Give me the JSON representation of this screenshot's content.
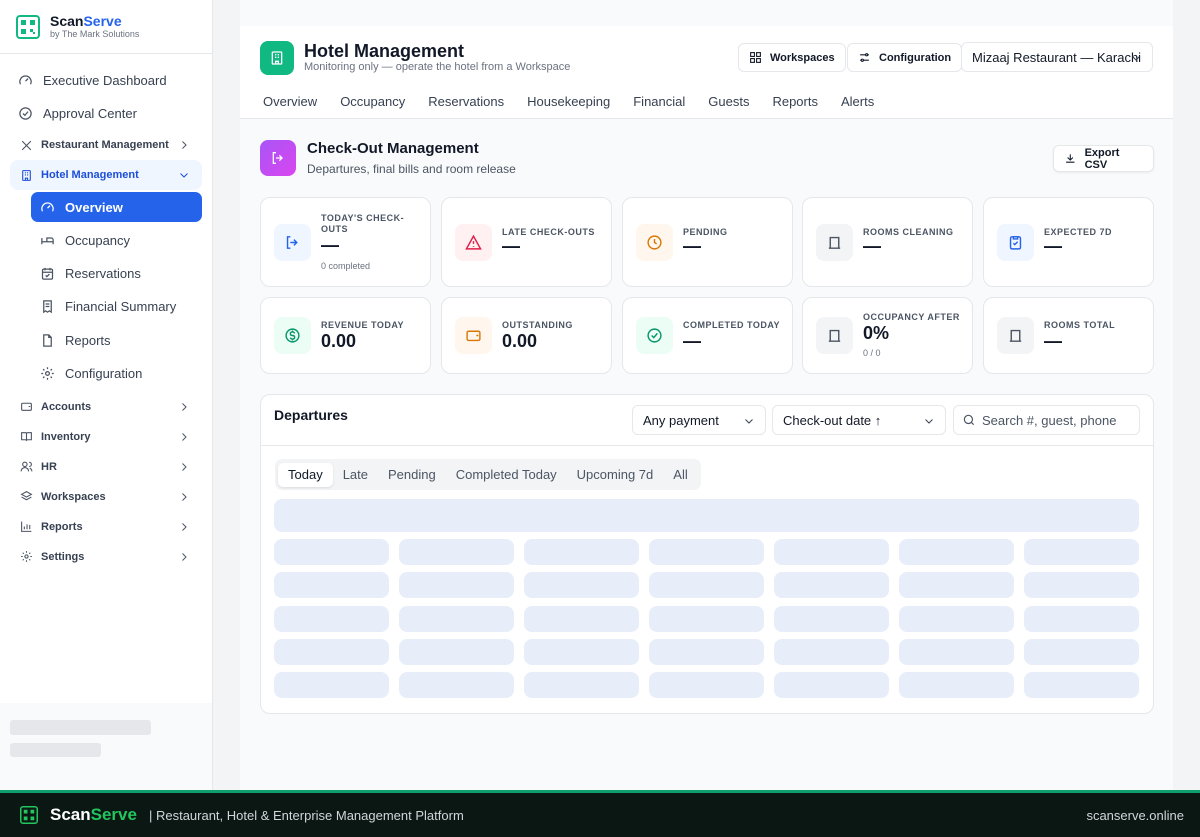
{
  "brand": {
    "name_main": "Scan",
    "name_accent": "Serve",
    "sub": "by The Mark Solutions"
  },
  "sidebar": {
    "top_items": [
      {
        "label": "Executive Dashboard",
        "icon": "gauge-icon"
      },
      {
        "label": "Approval Center",
        "icon": "check-circle-icon"
      }
    ],
    "groups_before": [
      {
        "label": "Restaurant Management",
        "icon": "utensils-icon"
      }
    ],
    "active_group": {
      "label": "Hotel Management",
      "icon": "building-icon"
    },
    "sub_items": [
      {
        "label": "Overview",
        "icon": "gauge-icon",
        "active": true
      },
      {
        "label": "Occupancy",
        "icon": "bed-icon"
      },
      {
        "label": "Reservations",
        "icon": "calendar-check-icon"
      },
      {
        "label": "Financial Summary",
        "icon": "receipt-icon"
      },
      {
        "label": "Reports",
        "icon": "file-icon"
      },
      {
        "label": "Configuration",
        "icon": "gear-icon"
      }
    ],
    "groups_after": [
      {
        "label": "Accounts",
        "icon": "wallet-icon"
      },
      {
        "label": "Inventory",
        "icon": "book-icon"
      },
      {
        "label": "HR",
        "icon": "users-icon"
      },
      {
        "label": "Workspaces",
        "icon": "layers-icon"
      },
      {
        "label": "Reports",
        "icon": "chart-icon"
      },
      {
        "label": "Settings",
        "icon": "gear-icon"
      }
    ]
  },
  "header": {
    "title": "Hotel Management",
    "subtitle": "Monitoring only — operate the hotel from a Workspace",
    "workspaces_label": "Workspaces",
    "configuration_label": "Configuration",
    "branch_select": "Mizaaj Restaurant — Karachi",
    "tabs": [
      "Overview",
      "Occupancy",
      "Reservations",
      "Housekeeping",
      "Financial",
      "Guests",
      "Reports",
      "Alerts"
    ]
  },
  "section": {
    "title": "Check-Out Management",
    "subtitle": "Departures, final bills and room release",
    "export_label": "Export CSV"
  },
  "stats": [
    {
      "label": "TODAY'S CHECK-OUTS",
      "value": "—",
      "sub": "0 completed",
      "icon": "logout-icon",
      "color": "#2563eb",
      "bg": "#eff6ff"
    },
    {
      "label": "LATE CHECK-OUTS",
      "value": "—",
      "sub": "",
      "icon": "alert-triangle-icon",
      "color": "#e11d48",
      "bg": "#fff1f2"
    },
    {
      "label": "PENDING",
      "value": "—",
      "sub": "",
      "icon": "clock-icon",
      "color": "#d97706",
      "bg": "#fff7ed"
    },
    {
      "label": "ROOMS CLEANING",
      "value": "—",
      "sub": "",
      "icon": "door-icon",
      "color": "#4b5563",
      "bg": "#f3f4f6"
    },
    {
      "label": "EXPECTED 7D",
      "value": "—",
      "sub": "",
      "icon": "clipboard-check-icon",
      "color": "#2563eb",
      "bg": "#eff6ff"
    },
    {
      "label": "REVENUE TODAY",
      "value": "0.00",
      "sub": "",
      "icon": "dollar-icon",
      "color": "#059669",
      "bg": "#ecfdf5"
    },
    {
      "label": "OUTSTANDING",
      "value": "0.00",
      "sub": "",
      "icon": "wallet-icon",
      "color": "#d97706",
      "bg": "#fff7ed"
    },
    {
      "label": "COMPLETED TODAY",
      "value": "—",
      "sub": "",
      "icon": "check-circle-icon",
      "color": "#059669",
      "bg": "#ecfdf5"
    },
    {
      "label": "OCCUPANCY AFTER",
      "value": "0%",
      "sub": "0 / 0",
      "icon": "door-icon",
      "color": "#4b5563",
      "bg": "#f3f4f6"
    },
    {
      "label": "ROOMS TOTAL",
      "value": "—",
      "sub": "",
      "icon": "door-icon",
      "color": "#4b5563",
      "bg": "#f3f4f6"
    }
  ],
  "departures": {
    "title": "Departures",
    "payment_filter": "Any payment",
    "sort_select": "Check-out date ↑",
    "search_placeholder": "Search #, guest, phone",
    "segments": [
      "Today",
      "Late",
      "Pending",
      "Completed Today",
      "Upcoming 7d",
      "All"
    ],
    "active_segment": "Today"
  },
  "footer": {
    "name_main": "Scan",
    "name_accent": "Serve",
    "tagline": "| Restaurant, Hotel & Enterprise Management Platform",
    "url": "scanserve.online"
  },
  "colors": {
    "accent": "#2563eb",
    "brand_green": "#10b981",
    "footer_bg": "#0b1713"
  }
}
